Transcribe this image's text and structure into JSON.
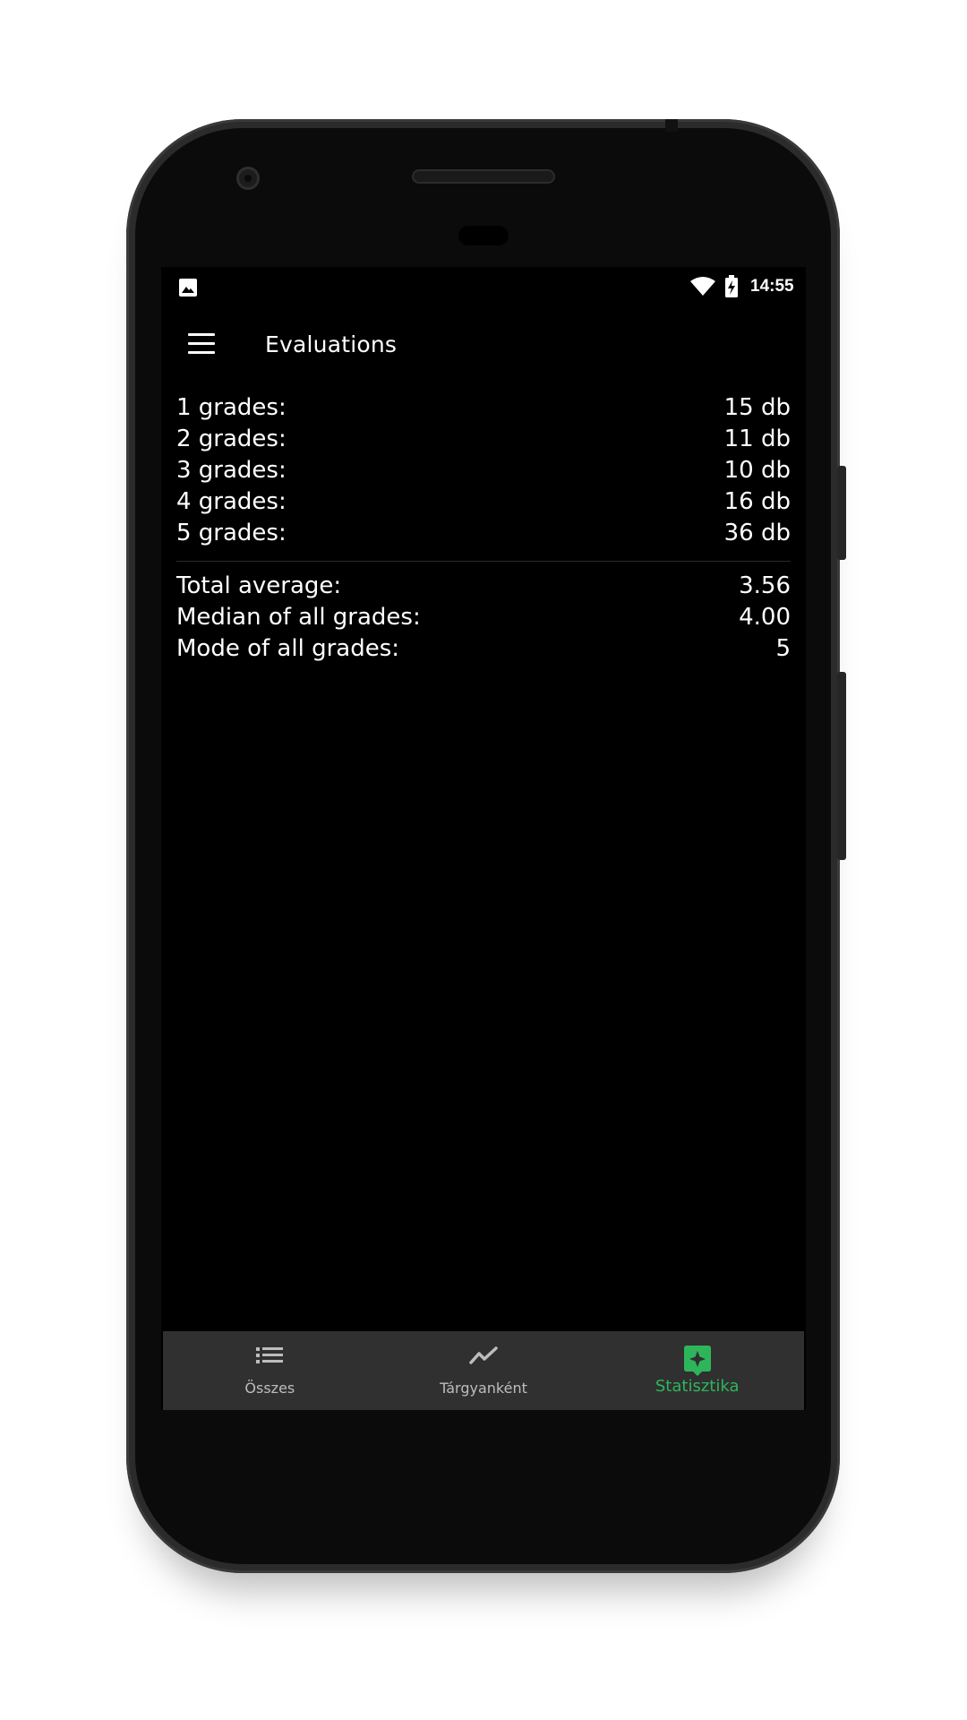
{
  "status_bar": {
    "time": "14:55",
    "icons": [
      "image-icon",
      "wifi-icon",
      "battery-charging-icon"
    ]
  },
  "app_bar": {
    "title": "Evaluations",
    "menu_icon": "menu-icon"
  },
  "grade_counts": [
    {
      "label": "1 grades:",
      "value": "15 db"
    },
    {
      "label": "2 grades:",
      "value": "11 db"
    },
    {
      "label": "3 grades:",
      "value": "10 db"
    },
    {
      "label": "4 grades:",
      "value": "16 db"
    },
    {
      "label": "5 grades:",
      "value": "36 db"
    }
  ],
  "summary": [
    {
      "label": "Total average:",
      "value": "3.56"
    },
    {
      "label": "Median of all grades:",
      "value": "4.00"
    },
    {
      "label": "Mode of all grades:",
      "value": "5"
    }
  ],
  "bottom_nav": {
    "items": [
      {
        "label": "Összes",
        "icon": "list-icon",
        "active": false
      },
      {
        "label": "Tárgyanként",
        "icon": "trending-icon",
        "active": false
      },
      {
        "label": "Statisztika",
        "icon": "sparkle-badge-icon",
        "active": true
      }
    ]
  },
  "colors": {
    "background": "#000000",
    "nav_background": "#303030",
    "accent": "#2eb55b",
    "text": "#ffffff",
    "nav_inactive": "#bdbdbd"
  }
}
